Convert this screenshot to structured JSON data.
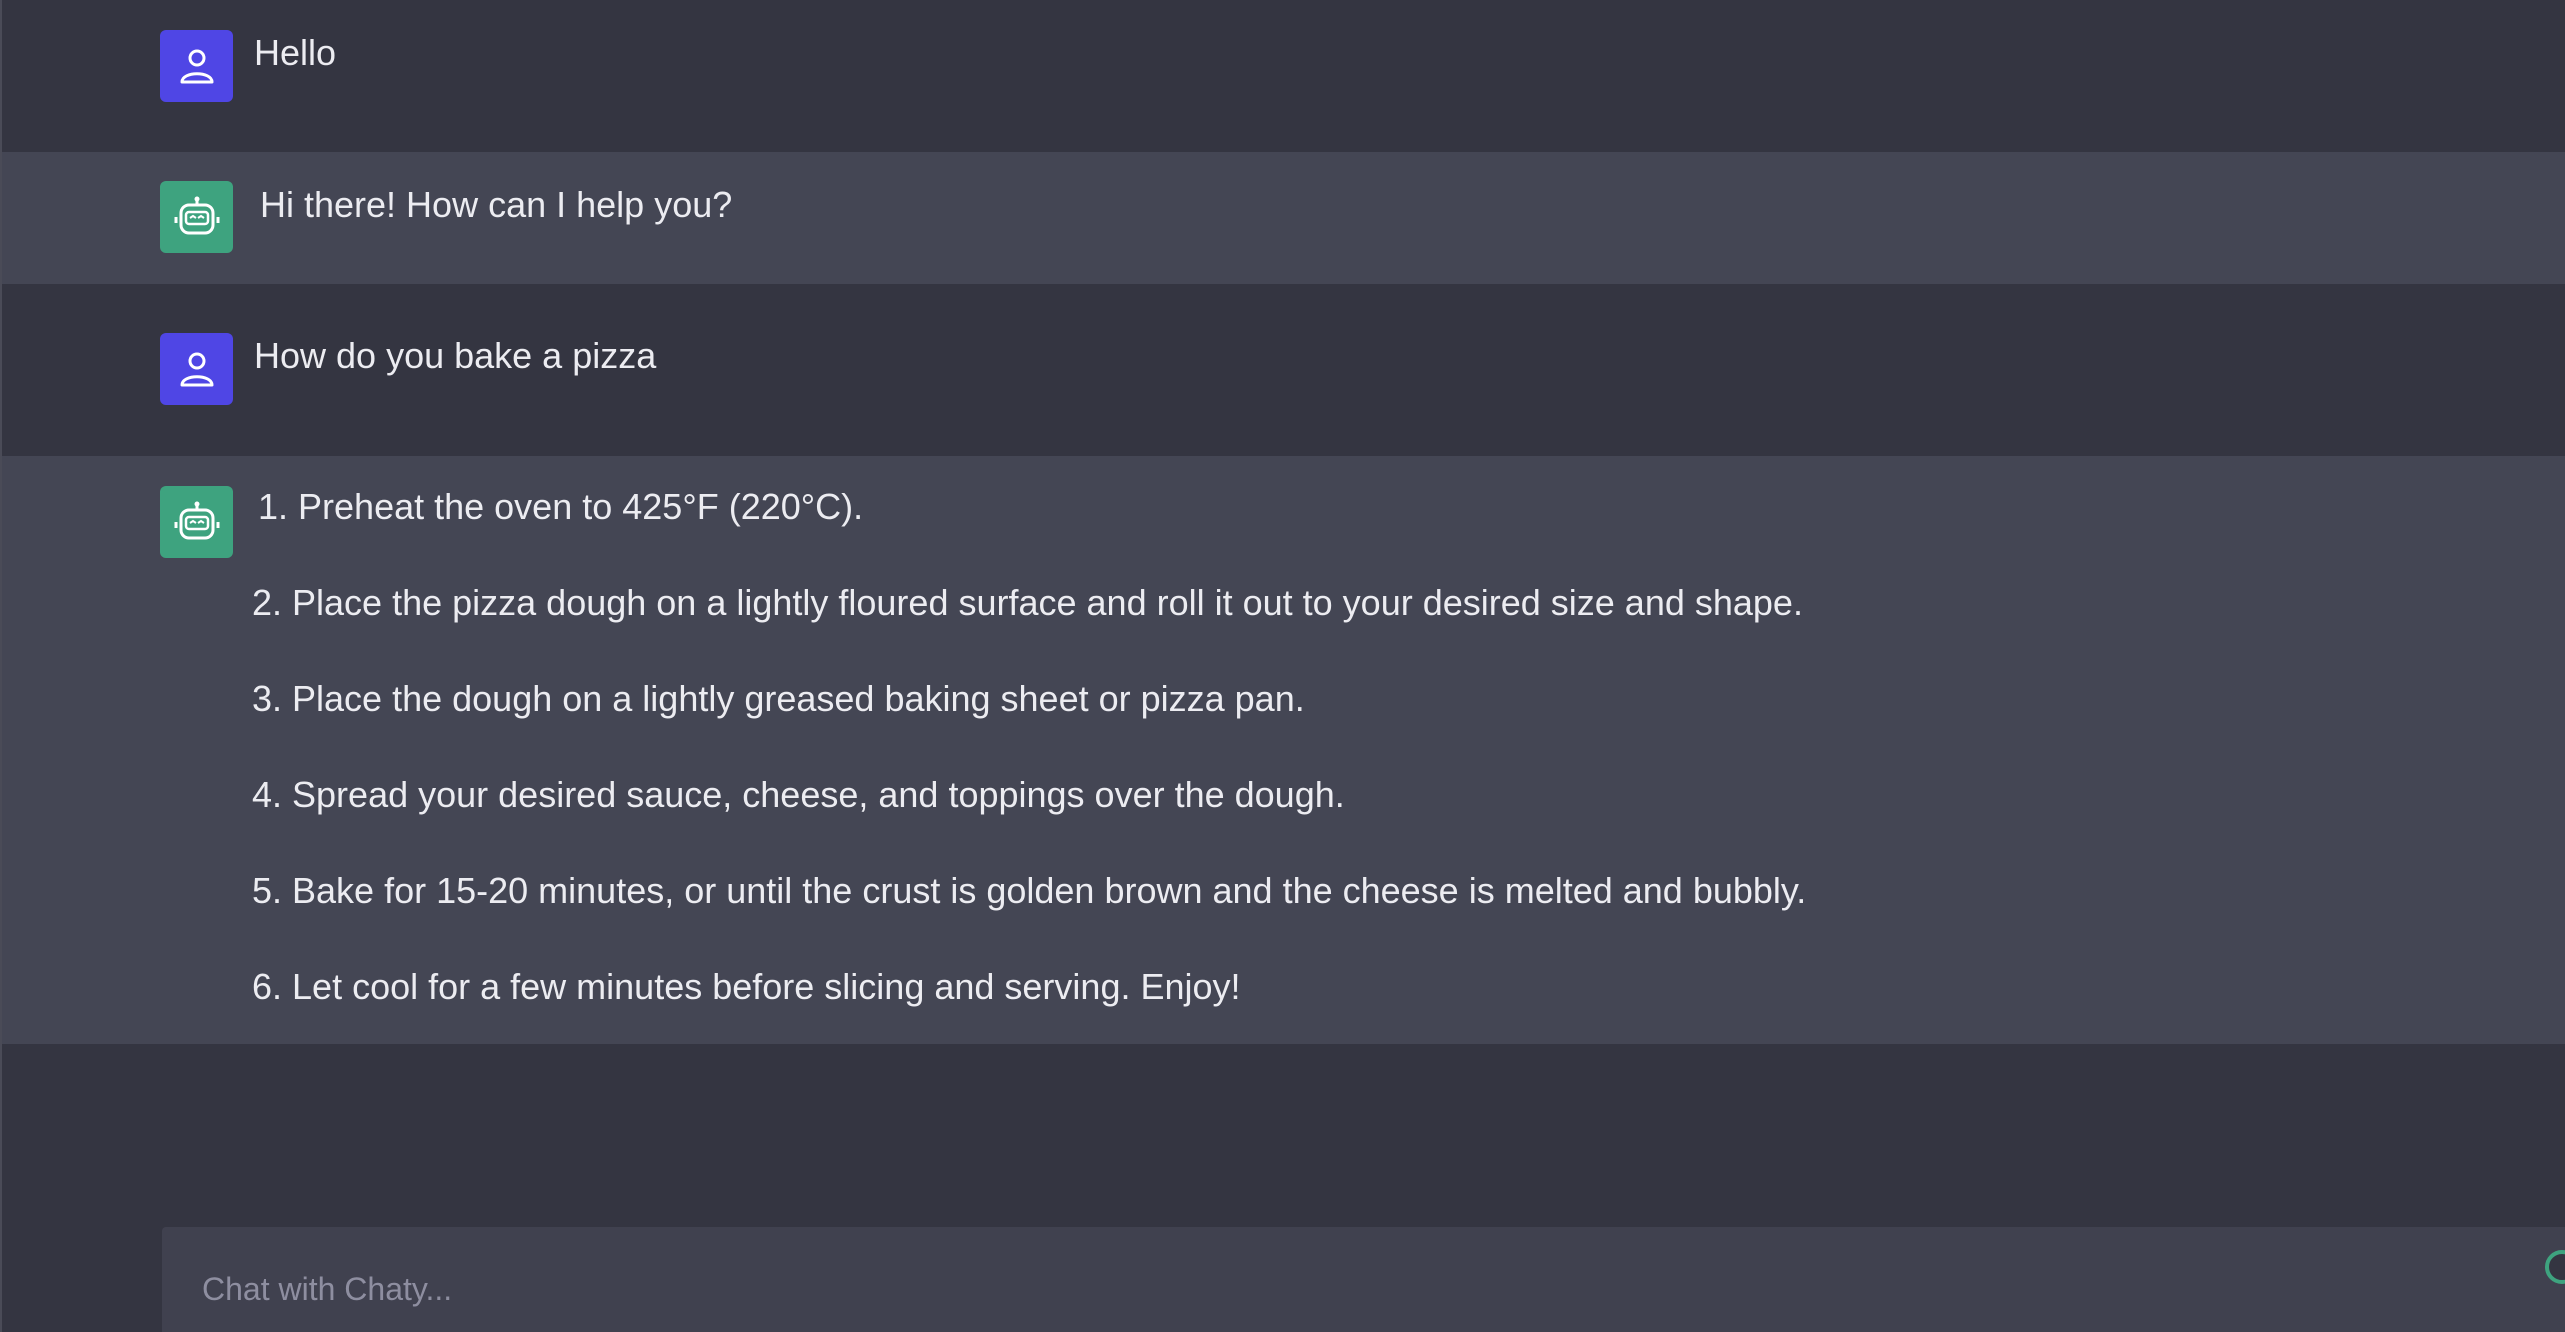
{
  "conversation": {
    "messages": [
      {
        "role": "user",
        "icon": "user-icon",
        "text": "Hello"
      },
      {
        "role": "assistant",
        "icon": "robot-icon",
        "text": "Hi there! How can I help you?"
      },
      {
        "role": "user",
        "icon": "user-icon",
        "text": "How do you bake a pizza"
      },
      {
        "role": "assistant",
        "icon": "robot-icon",
        "steps": [
          "1. Preheat the oven to 425°F (220°C).",
          "2. Place the pizza dough on a lightly floured surface and roll it out to your desired size and shape.",
          "3. Place the dough on a lightly greased baking sheet or pizza pan.",
          "4. Spread your desired sauce, cheese, and toppings over the dough.",
          "5. Bake for 15-20 minutes, or until the crust is golden brown and the cheese is melted and bubbly.",
          "6. Let cool for a few minutes before slicing and serving. Enjoy!"
        ]
      }
    ]
  },
  "composer": {
    "placeholder": "Chat with Chaty...",
    "value": ""
  },
  "colors": {
    "background": "#343541",
    "assistant_row": "#444654",
    "user_avatar": "#4f46e5",
    "assistant_avatar": "#3ea37f",
    "input_background": "#40414f"
  }
}
